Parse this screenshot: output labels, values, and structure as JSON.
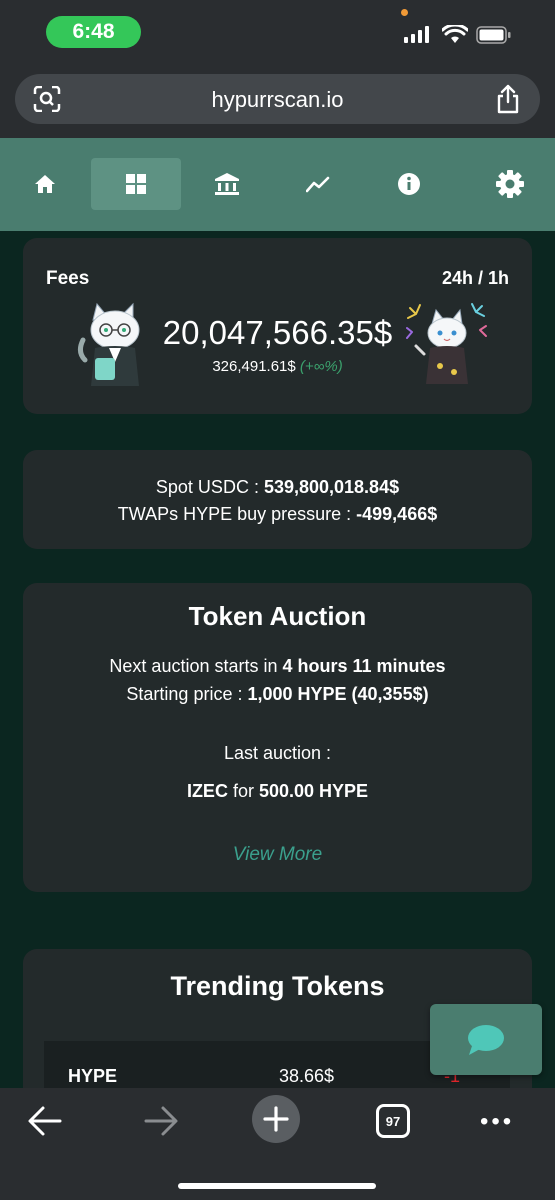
{
  "status_bar": {
    "time": "6:48"
  },
  "browser": {
    "url": "hypurrscan.io",
    "tab_count": "97"
  },
  "nav": {
    "items": [
      {
        "icon": "home-icon"
      },
      {
        "icon": "dashboard-icon",
        "active": true
      },
      {
        "icon": "bank-icon"
      },
      {
        "icon": "chart-trend-icon"
      },
      {
        "icon": "info-icon"
      },
      {
        "icon": "gear-icon"
      }
    ]
  },
  "fees": {
    "label": "Fees",
    "period": "24h / 1h",
    "total": "20,047,566.35$",
    "hourly": "326,491.61$",
    "change": "(+∞%)"
  },
  "spot": {
    "usdc_label": "Spot USDC : ",
    "usdc_value": "539,800,018.84$",
    "twap_label": "TWAPs HYPE buy pressure : ",
    "twap_value": "-499,466$"
  },
  "auction": {
    "title": "Token Auction",
    "next_label": "Next auction starts in ",
    "next_value": "4 hours 11 minutes",
    "price_label": "Starting price : ",
    "price_value": "1,000 HYPE (40,355$)",
    "last_label": "Last auction :",
    "last_token": "IZEC",
    "last_for": " for ",
    "last_price": "500.00 HYPE",
    "view_more": "View More"
  },
  "trending": {
    "title": "Trending Tokens",
    "rows": [
      {
        "symbol": "HYPE",
        "price": "38.66$",
        "change": "-1"
      }
    ]
  },
  "colors": {
    "background": "#0b2620",
    "card": "#232a2b",
    "nav": "#4a7d6f",
    "positive": "#3ba06c",
    "negative": "#e0262b",
    "link": "#3ba08d"
  }
}
